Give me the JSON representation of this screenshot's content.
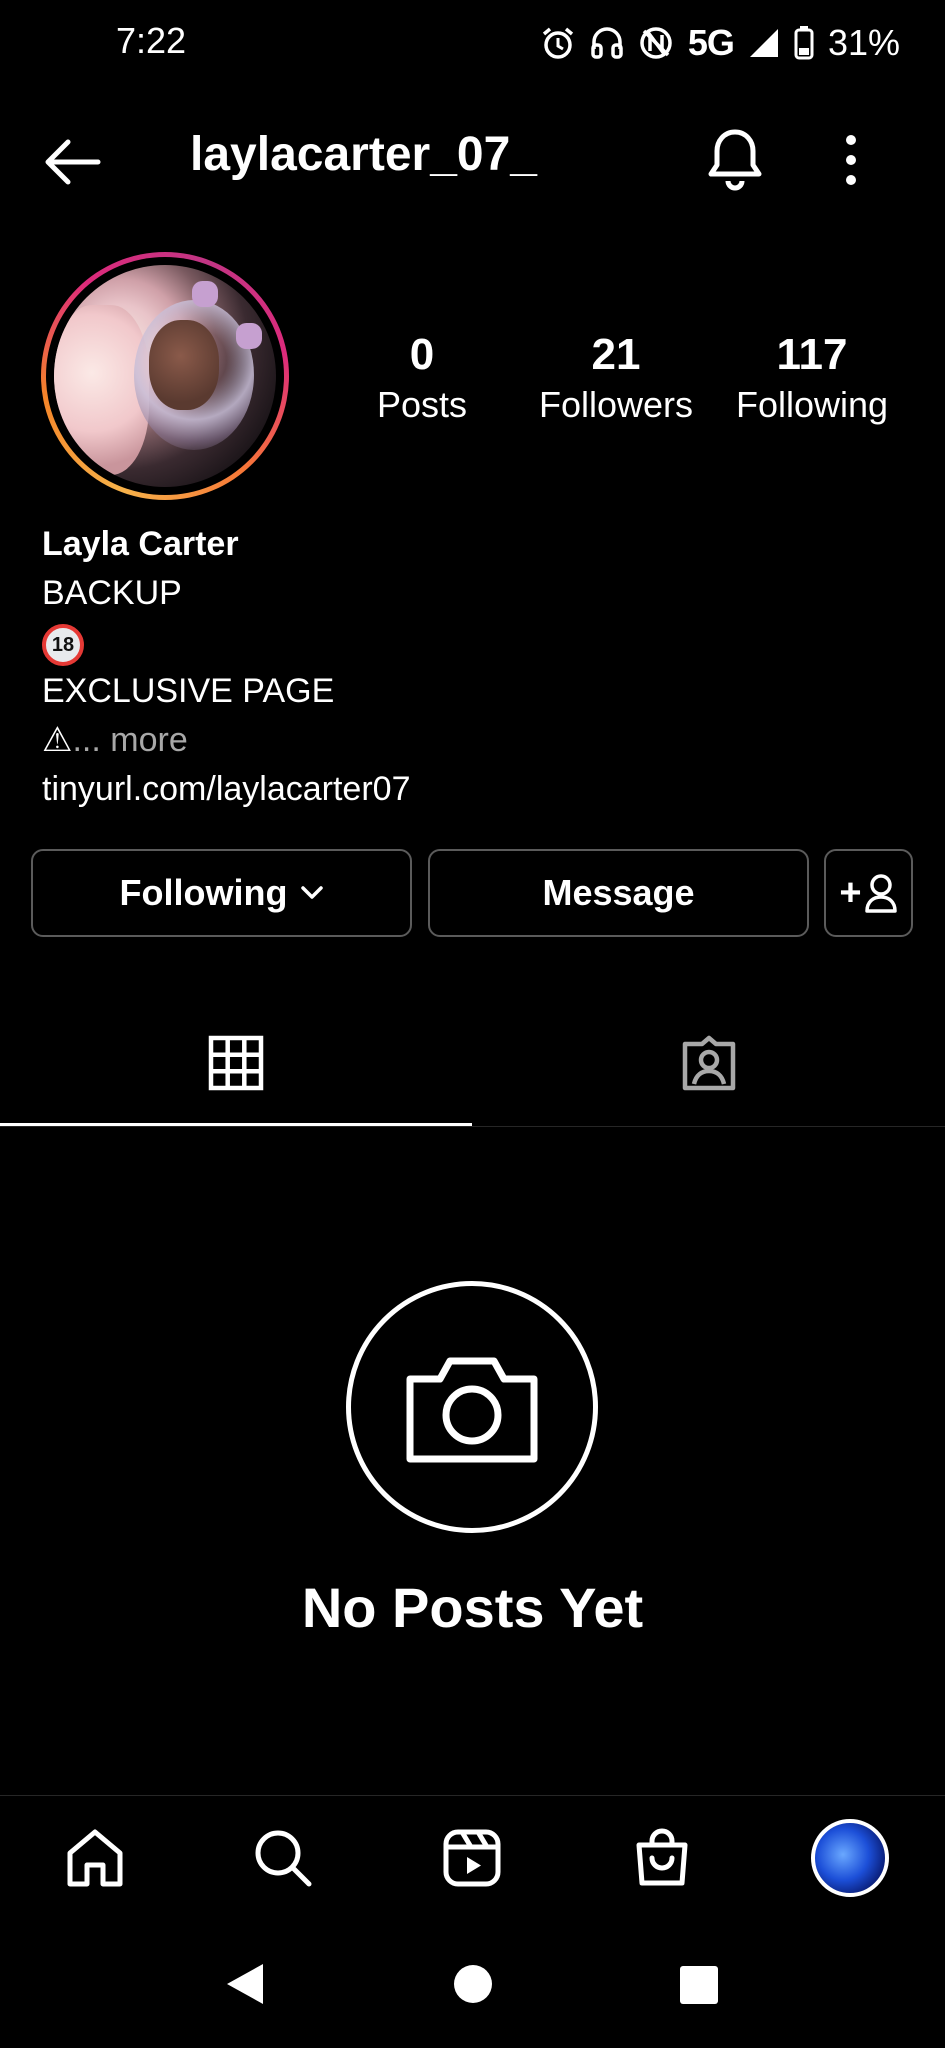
{
  "status_bar": {
    "time": "7:22",
    "network": "5G",
    "battery": "31%",
    "icons": [
      "alarm-icon",
      "headphones-icon",
      "nfc-icon",
      "signal-icon",
      "battery-icon"
    ]
  },
  "header": {
    "username": "laylacarter_07_",
    "icons": [
      "back-arrow-icon",
      "bell-icon",
      "more-vertical-icon"
    ]
  },
  "stats": {
    "posts": {
      "value": "0",
      "label": "Posts"
    },
    "followers": {
      "value": "21",
      "label": "Followers"
    },
    "following": {
      "value": "117",
      "label": "Following"
    }
  },
  "bio": {
    "name": "Layla Carter",
    "line1": "BACKUP",
    "badge": "18",
    "line2": "EXCLUSIVE PAGE",
    "warning": "⚠",
    "more": "... more",
    "link": "tinyurl.com/laylacarter07"
  },
  "buttons": {
    "following": "Following",
    "message": "Message",
    "add_user": "+"
  },
  "tabs": [
    "grid-icon",
    "tagged-icon"
  ],
  "empty_state": {
    "title": "No Posts Yet"
  },
  "bottom_nav": [
    "home-icon",
    "search-icon",
    "reels-icon",
    "shop-icon",
    "profile-avatar"
  ],
  "colors": {
    "background": "#000000",
    "text": "#ffffff",
    "muted": "#a8a8a8",
    "button_border": "#5b5b5b"
  }
}
